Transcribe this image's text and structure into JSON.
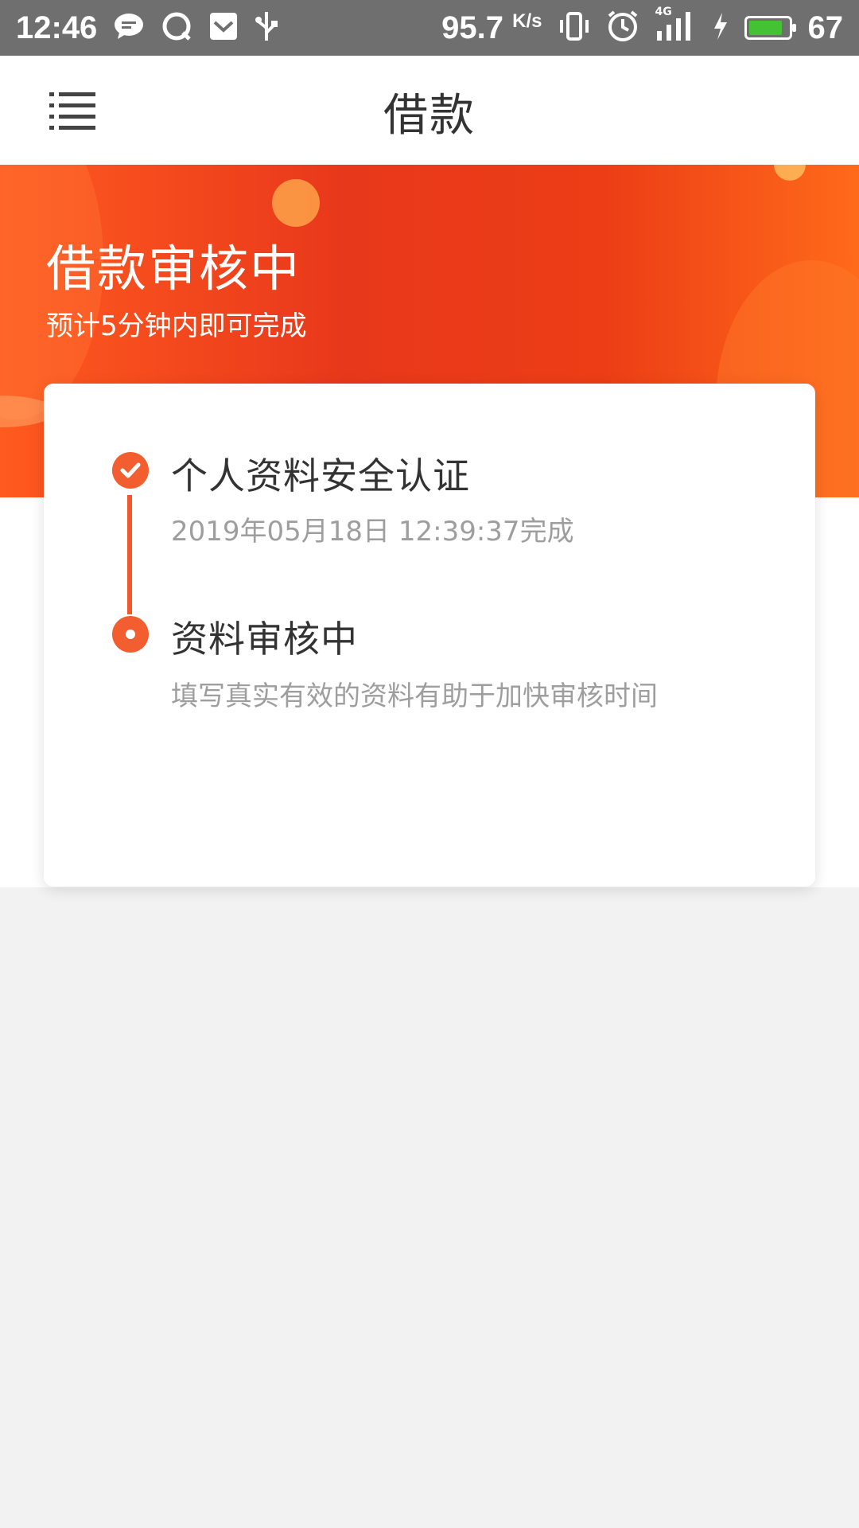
{
  "status_bar": {
    "time": "12:46",
    "net_speed": "95.7",
    "net_unit": "K/s",
    "network": "4G",
    "battery": "67",
    "icons": [
      "message-icon",
      "qq-icon",
      "mail-icon",
      "usb-icon",
      "vibrate-icon",
      "alarm-icon",
      "signal-icon",
      "charging-icon",
      "battery-icon"
    ]
  },
  "app_bar": {
    "title": "借款",
    "menu_icon": "menu-icon"
  },
  "banner": {
    "title": "借款审核中",
    "subtitle": "预计5分钟内即可完成"
  },
  "steps": [
    {
      "title": "个人资料安全认证",
      "description": "2019年05月18日 12:39:37完成",
      "status": "done"
    },
    {
      "title": "资料审核中",
      "description": "填写真实有效的资料有助于加快审核时间",
      "status": "current"
    }
  ],
  "colors": {
    "accent": "#f25e2f",
    "banner": "#e8381b",
    "status_bar": "#6f6f6f"
  }
}
